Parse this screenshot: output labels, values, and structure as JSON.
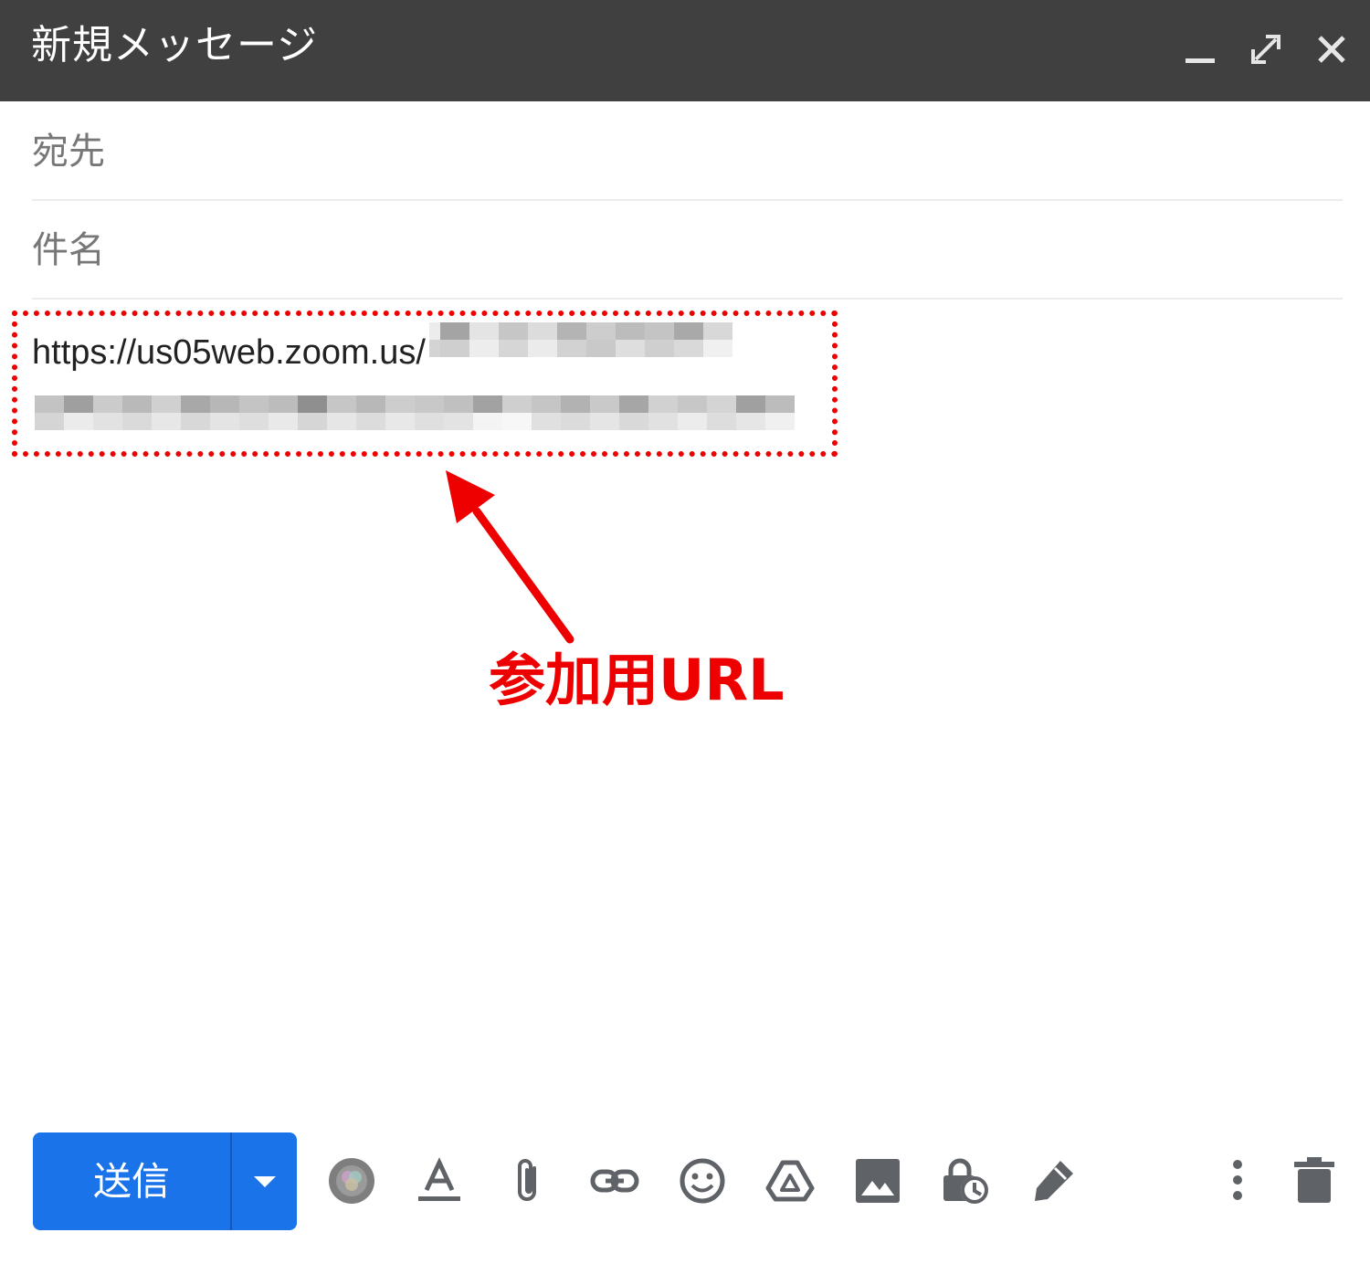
{
  "window": {
    "title": "新規メッセージ"
  },
  "compose": {
    "to_label": "宛先",
    "subject_label": "件名",
    "body_url_visible": "https://us05web.zoom.us/"
  },
  "annotation": {
    "label": "参加用URL",
    "color": "#ee0000"
  },
  "footer": {
    "send_label": "送信",
    "send_color": "#1a73e8"
  },
  "icons": {
    "minimize": "minimize-icon",
    "expand": "expand-icon",
    "close": "close-icon",
    "send_options": "caret-down-icon",
    "toolbar": [
      "meet-icon",
      "text-format-icon",
      "attachment-icon",
      "link-icon",
      "emoji-icon",
      "drive-icon",
      "photo-icon",
      "confidential-mode-icon",
      "signature-icon",
      "more-options-icon",
      "trash-icon"
    ]
  }
}
